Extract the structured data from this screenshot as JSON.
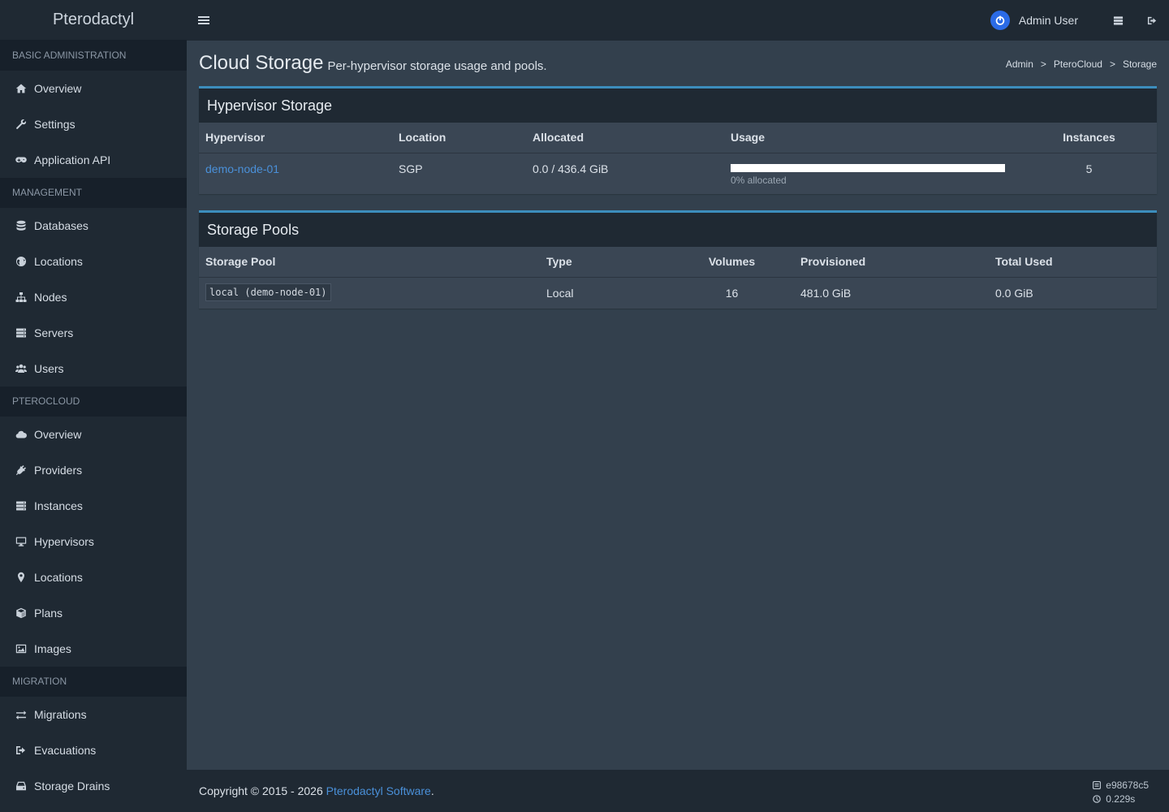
{
  "brand": "Pterodactyl",
  "sidebar": {
    "sections": [
      {
        "header": "BASIC ADMINISTRATION",
        "items": [
          {
            "label": "Overview",
            "icon": "home-icon"
          },
          {
            "label": "Settings",
            "icon": "wrench-icon"
          },
          {
            "label": "Application API",
            "icon": "gamepad-icon"
          }
        ]
      },
      {
        "header": "MANAGEMENT",
        "items": [
          {
            "label": "Databases",
            "icon": "database-icon"
          },
          {
            "label": "Locations",
            "icon": "globe-icon"
          },
          {
            "label": "Nodes",
            "icon": "sitemap-icon"
          },
          {
            "label": "Servers",
            "icon": "server-icon"
          },
          {
            "label": "Users",
            "icon": "users-icon"
          }
        ]
      },
      {
        "header": "PTEROCLOUD",
        "items": [
          {
            "label": "Overview",
            "icon": "cloud-icon"
          },
          {
            "label": "Providers",
            "icon": "plug-icon"
          },
          {
            "label": "Instances",
            "icon": "server-icon"
          },
          {
            "label": "Hypervisors",
            "icon": "desktop-icon"
          },
          {
            "label": "Locations",
            "icon": "map-marker-icon"
          },
          {
            "label": "Plans",
            "icon": "cube-icon"
          },
          {
            "label": "Images",
            "icon": "image-icon"
          }
        ]
      },
      {
        "header": "MIGRATION",
        "items": [
          {
            "label": "Migrations",
            "icon": "exchange-icon"
          },
          {
            "label": "Evacuations",
            "icon": "sign-out-icon"
          },
          {
            "label": "Storage Drains",
            "icon": "hdd-icon"
          }
        ]
      }
    ]
  },
  "topbar": {
    "user_name": "Admin User"
  },
  "page": {
    "title": "Cloud Storage",
    "subtitle": "Per-hypervisor storage usage and pools.",
    "breadcrumb": [
      "Admin",
      "PteroCloud",
      "Storage"
    ],
    "breadcrumb_sep": ">"
  },
  "hypervisor_storage": {
    "title": "Hypervisor Storage",
    "columns": [
      "Hypervisor",
      "Location",
      "Allocated",
      "Usage",
      "Instances"
    ],
    "rows": [
      {
        "hypervisor": "demo-node-01",
        "location": "SGP",
        "allocated": "0.0 / 436.4 GiB",
        "usage_percent": 0,
        "usage_label": "0% allocated",
        "instances": "5"
      }
    ]
  },
  "storage_pools": {
    "title": "Storage Pools",
    "columns": [
      "Storage Pool",
      "Type",
      "Volumes",
      "Provisioned",
      "Total Used"
    ],
    "rows": [
      {
        "pool": "local (demo-node-01)",
        "type": "Local",
        "volumes": "16",
        "provisioned": "481.0 GiB",
        "total_used": "0.0 GiB"
      }
    ]
  },
  "footer": {
    "copyright": "Copyright © 2015 - 2026 ",
    "link_text": "Pterodactyl Software",
    "period": ".",
    "commit": "e98678c5",
    "time": "0.229s"
  },
  "colors": {
    "accent": "#3c8dbc",
    "sidebar_bg": "#1f2933",
    "content_bg": "#33404d",
    "link": "#4a90d9",
    "avatar": "#2b6be6"
  }
}
